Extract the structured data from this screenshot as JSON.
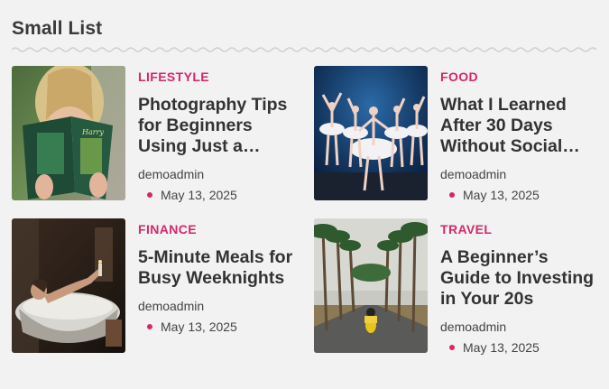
{
  "widget": {
    "title": "Small List"
  },
  "colors": {
    "accent": "#d4286c",
    "background": "#f2f2f2",
    "text": "#333333"
  },
  "posts": [
    {
      "category": "LIFESTYLE",
      "title": "Photography Tips for Beginners Using Just a…",
      "author": "demoadmin",
      "date": "May 13, 2025",
      "image": "woman-reading-book"
    },
    {
      "category": "FOOD",
      "title": "What I Learned After 30 Days Without Social…",
      "author": "demoadmin",
      "date": "May 13, 2025",
      "image": "ballet-dancers"
    },
    {
      "category": "FINANCE",
      "title": "5-Minute Meals for Busy Weeknights",
      "author": "demoadmin",
      "date": "May 13, 2025",
      "image": "woman-in-bathtub"
    },
    {
      "category": "TRAVEL",
      "title": "A Beginner’s Guide to Investing in Your 20s",
      "author": "demoadmin",
      "date": "May 13, 2025",
      "image": "palm-road-scooter"
    }
  ]
}
